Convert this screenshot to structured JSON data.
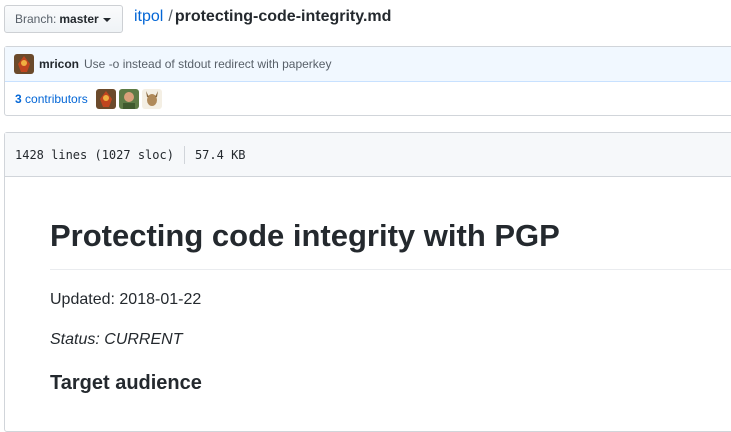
{
  "branch": {
    "label": "Branch:",
    "value": "master"
  },
  "breadcrumb": {
    "repo": "itpol",
    "separator": "/",
    "file": "protecting-code-integrity.md"
  },
  "commit": {
    "author": "mricon",
    "message": "Use -o instead of stdout redirect with paperkey"
  },
  "contributors": {
    "count": "3",
    "label": "contributors",
    "avatars": [
      "mricon-avatar",
      "contributor-avatar-2",
      "contributor-avatar-3"
    ]
  },
  "file_info": {
    "lines": "1428 lines (1027 sloc)",
    "size": "57.4 KB"
  },
  "content": {
    "title": "Protecting code integrity with PGP",
    "updated_label": "Updated:",
    "updated_value": "2018-01-22",
    "status_label": "Status:",
    "status_value": "CURRENT",
    "section_heading": "Target audience"
  },
  "colors": {
    "link": "#0366d6",
    "commit_bg": "#f1f8ff",
    "header_bg": "#f6f8fa",
    "text": "#24292e"
  }
}
